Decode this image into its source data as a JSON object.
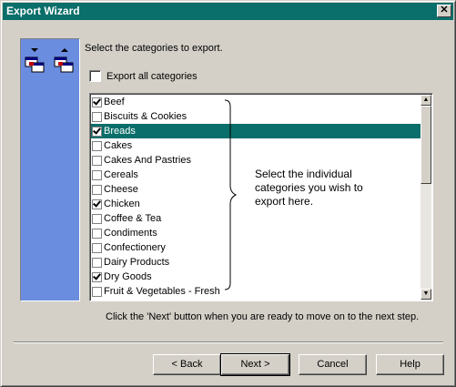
{
  "window": {
    "title": "Export Wizard",
    "close_glyph": "✕"
  },
  "instructions": "Select the categories to export.",
  "export_all": {
    "label": "Export all categories",
    "checked": false
  },
  "categories": [
    {
      "label": "Beef",
      "checked": true,
      "selected": false
    },
    {
      "label": "Biscuits & Cookies",
      "checked": false,
      "selected": false
    },
    {
      "label": "Breads",
      "checked": true,
      "selected": true
    },
    {
      "label": "Cakes",
      "checked": false,
      "selected": false
    },
    {
      "label": "Cakes And Pastries",
      "checked": false,
      "selected": false
    },
    {
      "label": "Cereals",
      "checked": false,
      "selected": false
    },
    {
      "label": "Cheese",
      "checked": false,
      "selected": false
    },
    {
      "label": "Chicken",
      "checked": true,
      "selected": false
    },
    {
      "label": "Coffee & Tea",
      "checked": false,
      "selected": false
    },
    {
      "label": "Condiments",
      "checked": false,
      "selected": false
    },
    {
      "label": "Confectionery",
      "checked": false,
      "selected": false
    },
    {
      "label": "Dairy Products",
      "checked": false,
      "selected": false
    },
    {
      "label": "Dry Goods",
      "checked": true,
      "selected": false
    },
    {
      "label": "Fruit & Vegetables - Fresh",
      "checked": false,
      "selected": false
    }
  ],
  "callout": "Select the individual categories you wish to export here.",
  "next_hint": "Click the 'Next' button when you are ready to move on to the next step.",
  "buttons": {
    "back": "< Back",
    "next": "Next >",
    "cancel": "Cancel",
    "help": "Help"
  },
  "colors": {
    "title_bar": "#0a6e6a",
    "side_panel": "#6b8de0",
    "selection": "#0a6e6a"
  },
  "icons": [
    "export-tables-icon",
    "import-tables-icon",
    "scroll-up-arrow-icon",
    "scroll-down-arrow-icon"
  ]
}
